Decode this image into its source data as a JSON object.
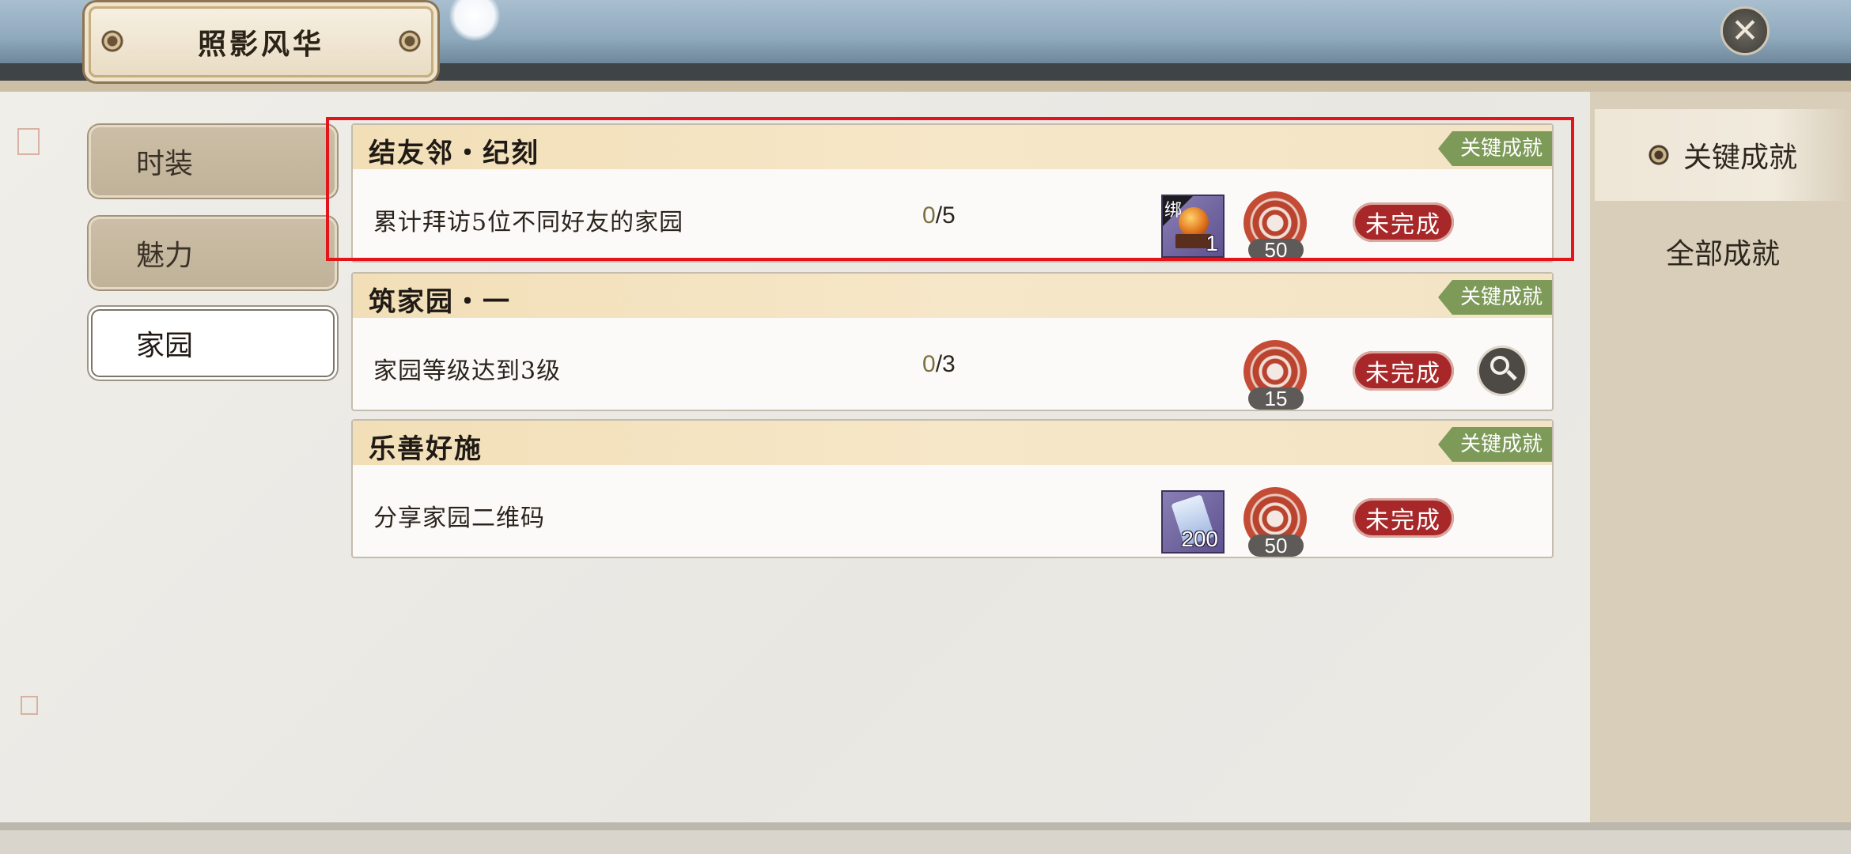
{
  "window": {
    "title": "照影风华"
  },
  "left_tabs": [
    {
      "label": "时装",
      "active": false
    },
    {
      "label": "魅力",
      "active": false
    },
    {
      "label": "家园",
      "active": true
    }
  ],
  "right_tabs": [
    {
      "label": "关键成就",
      "active": true
    },
    {
      "label": "全部成就",
      "active": false
    }
  ],
  "achievements": [
    {
      "title": "结友邻・纪刻",
      "tag": "关键成就",
      "desc": "累计拜访5位不同好友的家园",
      "progress_current": "0",
      "progress_total": "/5",
      "item": {
        "icon": "orb-item-icon",
        "bound_label": "绑",
        "count": "1"
      },
      "medal_count": "50",
      "status": "未完成",
      "has_search": false
    },
    {
      "title": "筑家园・一",
      "tag": "关键成就",
      "desc": "家园等级达到3级",
      "progress_current": "0",
      "progress_total": "/3",
      "item": null,
      "medal_count": "15",
      "status": "未完成",
      "has_search": true
    },
    {
      "title": "乐善好施",
      "tag": "关键成就",
      "desc": "分享家园二维码",
      "progress_current": "",
      "progress_total": "",
      "item": {
        "icon": "scroll-item-icon",
        "count": "200"
      },
      "medal_count": "50",
      "status": "未完成",
      "has_search": false
    }
  ],
  "colors": {
    "status_incomplete": "#a8282a",
    "key_tag": "#7d9a59",
    "highlight": "#e3141a"
  }
}
